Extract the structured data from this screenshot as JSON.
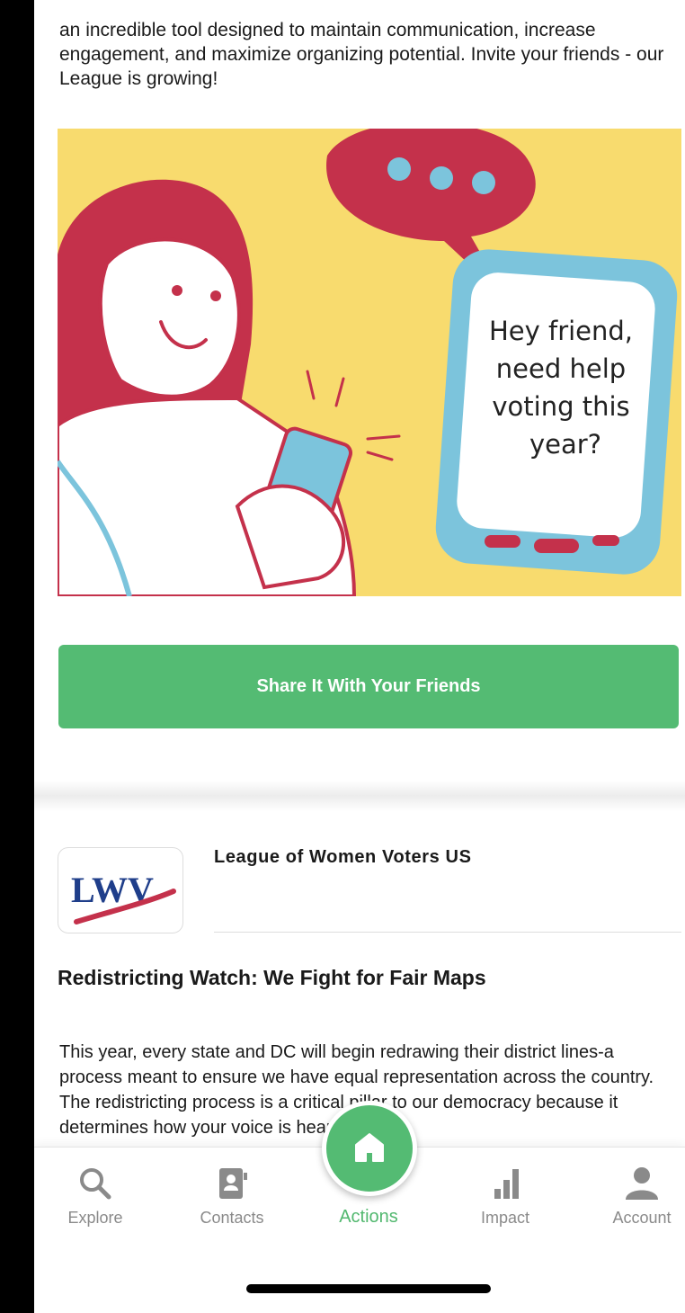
{
  "intro": {
    "text": "an incredible tool designed to maintain communication, increase engagement, and maximize organizing potential. Invite your friends - our League is growing!"
  },
  "illustration": {
    "phone_message_lines": [
      "Hey friend,",
      "need help",
      "voting this",
      "year?"
    ],
    "colors": {
      "background": "#f8db6e",
      "red": "#c4314b",
      "blue": "#7cc4dc"
    }
  },
  "share_button": {
    "label": "Share It With Your Friends",
    "color": "#54bb73"
  },
  "org": {
    "name": "League of Women Voters US",
    "logo_text": "LWV"
  },
  "post": {
    "title": "Redistricting Watch: We Fight for Fair Maps",
    "body": "This year, every state and DC will begin redrawing their district lines-a process meant to ensure we have equal representation across the country. The redistricting process is a critical pillar to our democracy because it determines how your voice is heard."
  },
  "tabbar": {
    "tabs": [
      {
        "label": "Explore",
        "icon": "search-icon"
      },
      {
        "label": "Contacts",
        "icon": "contact-book-icon"
      },
      {
        "label": "Actions",
        "icon": "home-icon",
        "active": true
      },
      {
        "label": "Impact",
        "icon": "bar-chart-icon"
      },
      {
        "label": "Account",
        "icon": "person-icon"
      }
    ],
    "active_color": "#52b86f"
  }
}
